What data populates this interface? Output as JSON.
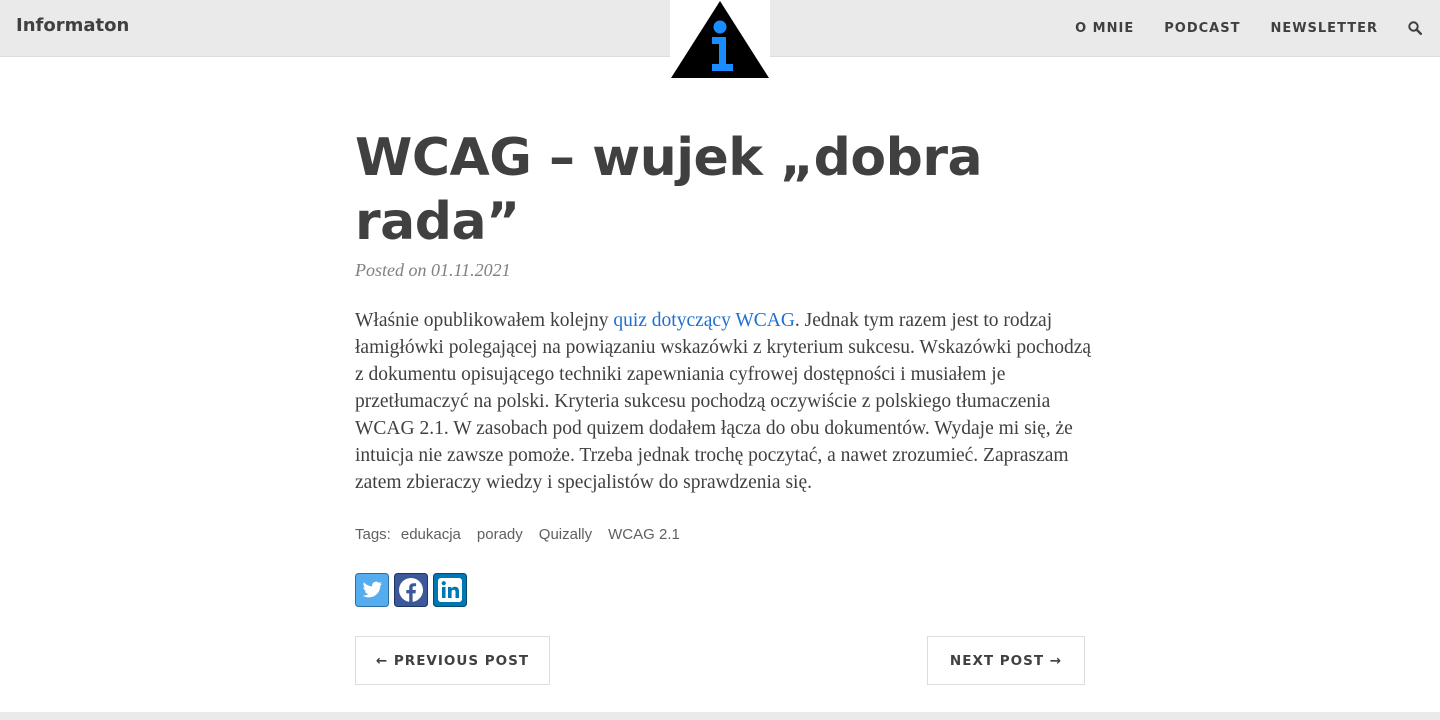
{
  "header": {
    "brand": "Informaton",
    "nav": [
      "O MNIE",
      "PODCAST",
      "NEWSLETTER"
    ],
    "search_icon": "search-icon",
    "logo_icon": "info-triangle-logo"
  },
  "post": {
    "title": "WCAG – wujek „dobra rada”",
    "meta": "Posted on 01.11.2021",
    "body_before_link": "Właśnie opublikowałem kolejny ",
    "body_link": "quiz dotyczący WCAG",
    "body_after_link": ". Jednak tym razem jest to rodzaj łamigłówki polegającej na powiązaniu wskazówki z kryterium sukcesu. Wskazówki pochodzą z dokumentu opisującego techniki zapewniania cyfrowej dostępności i musiałem je przetłumaczyć na polski. Kryteria sukcesu pochodzą oczywiście z polskiego tłumaczenia WCAG 2.1. W zasobach pod quizem dodałem łącza do obu dokumentów. Wydaje mi się, że intuicja nie zawsze pomoże. Trzeba jednak trochę poczytać, a nawet zrozumieć. Zapraszam zatem zbieraczy wiedzy i specjalistów do sprawdzenia się.",
    "tags_label": "Tags:",
    "tags": [
      "edukacja",
      "porady",
      "Quizally",
      "WCAG 2.1"
    ]
  },
  "share": [
    {
      "icon": "twitter-icon",
      "color": "#55acee"
    },
    {
      "icon": "facebook-icon",
      "color": "#3b5998"
    },
    {
      "icon": "linkedin-icon",
      "color": "#0077b5"
    }
  ],
  "pager": {
    "prev": "← PREVIOUS POST",
    "next": "NEXT POST →"
  },
  "colors": {
    "header_bg": "#eaeaea",
    "link": "#1f6fd1",
    "text": "#404040",
    "logo_blue": "#1a8cff"
  }
}
